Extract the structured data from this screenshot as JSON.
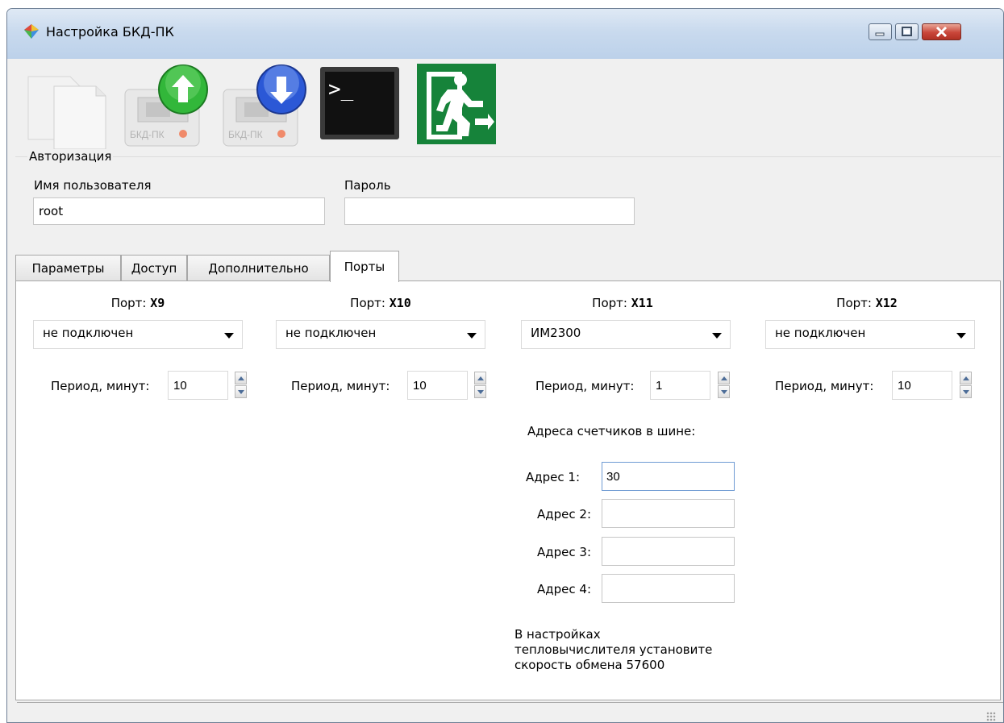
{
  "window": {
    "title": "Настройка БКД-ПК",
    "app_icon": "colorful-diamond-icon",
    "controls": [
      "minimize",
      "maximize",
      "close"
    ]
  },
  "toolbar": [
    {
      "name": "new-document-icon",
      "label": ""
    },
    {
      "name": "upload-to-device-icon",
      "label": "БКД-ПК"
    },
    {
      "name": "download-from-device-icon",
      "label": "БКД-ПК"
    },
    {
      "name": "terminal-icon",
      "label": ">_"
    },
    {
      "name": "exit-icon",
      "label": ""
    }
  ],
  "auth": {
    "legend": "Авторизация",
    "username_label": "Имя пользователя",
    "username_value": "root",
    "password_label": "Пароль",
    "password_value": ""
  },
  "tabs": [
    "Параметры",
    "Доступ",
    "Дополнительно",
    "Порты"
  ],
  "active_tab": "Порты",
  "ports": [
    {
      "prefix": "Порт: ",
      "name": "X9",
      "device": "не подключен",
      "period_label": "Период, минут:",
      "period": "10"
    },
    {
      "prefix": "Порт: ",
      "name": "X10",
      "device": "не подключен",
      "period_label": "Период, минут:",
      "period": "10"
    },
    {
      "prefix": "Порт: ",
      "name": "X11",
      "device": "ИМ2300",
      "period_label": "Период, минут:",
      "period": "1"
    },
    {
      "prefix": "Порт: ",
      "name": "X12",
      "device": "не подключен",
      "period_label": "Период, минут:",
      "period": "10"
    }
  ],
  "addresses": {
    "heading": "Адреса счетчиков в шине:",
    "items": [
      {
        "label": "Адрес 1:",
        "value": "30"
      },
      {
        "label": "Адрес 2:",
        "value": ""
      },
      {
        "label": "Адрес 3:",
        "value": ""
      },
      {
        "label": "Адрес 4:",
        "value": ""
      }
    ]
  },
  "note": "В настройках\nтепловычислителя установите\nскорость обмена 57600",
  "colors": {
    "title_bar": "#c9daee",
    "close_red": "#c9463a",
    "upload_green": "#2fb53a",
    "download_blue": "#2b58d6",
    "exit_green": "#16833a"
  }
}
